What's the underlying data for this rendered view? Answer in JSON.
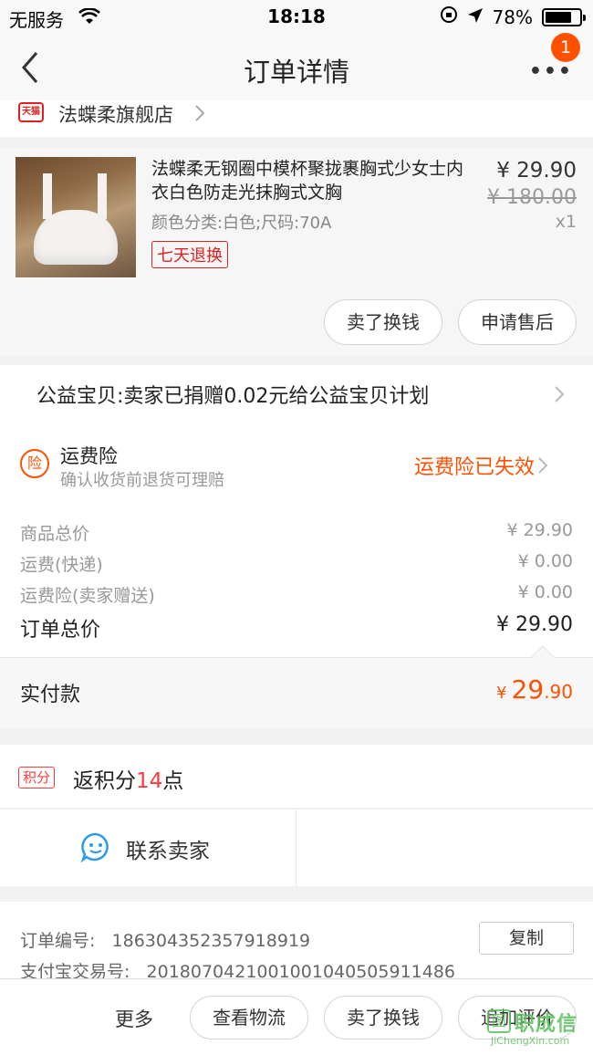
{
  "status_bar": {
    "carrier": "无服务",
    "time": "18:18",
    "battery": "78%"
  },
  "nav": {
    "title": "订单详情",
    "badge": "1",
    "more": "•••"
  },
  "store": {
    "tmall_label": "天猫",
    "name": "法蝶柔旗舰店"
  },
  "product": {
    "title": "法蝶柔无钢圈中模杯聚拢裹胸式少女士内衣白色防走光抹胸式文胸",
    "spec": "颜色分类:白色;尺码:70A",
    "tag": "七天退换",
    "price": "¥ 29.90",
    "original_price": "¥ 180.00",
    "quantity": "x1",
    "sell_button": "卖了换钱",
    "after_sale_button": "申请售后"
  },
  "charity": {
    "text": "公益宝贝:卖家已捐赠0.02元给公益宝贝计划"
  },
  "insurance": {
    "icon_label": "险",
    "title": "运费险",
    "subtitle": "确认收货前退货可理赔",
    "status": "运费险已失效"
  },
  "costs": [
    {
      "label": "商品总价",
      "value": "¥ 29.90"
    },
    {
      "label": "运费(快递)",
      "value": "¥ 0.00"
    },
    {
      "label": "运费险(卖家赠送)",
      "value": "¥ 0.00"
    }
  ],
  "order_total": {
    "label": "订单总价",
    "value": "¥ 29.90"
  },
  "paid": {
    "label": "实付款",
    "currency": "¥",
    "integer": "29",
    "decimal": ".90"
  },
  "points": {
    "tag": "积分",
    "prefix": "返积分",
    "number": "14",
    "suffix": "点"
  },
  "contact": {
    "label": "联系卖家"
  },
  "order_info": {
    "order_no_label": "订单编号:",
    "order_no": "186304352357918919",
    "alipay_label": "支付宝交易号:",
    "alipay_no": "2018070421001001040505911486",
    "copy_button": "复制"
  },
  "bottom_bar": {
    "more": "更多",
    "logistics": "查看物流",
    "sell": "卖了换钱",
    "review": "追加评价"
  },
  "watermark": {
    "mark": "图",
    "text": "职成信",
    "url": "JiChengXin.com"
  },
  "colors": {
    "accent": "#ff5000",
    "red": "#e02020"
  }
}
